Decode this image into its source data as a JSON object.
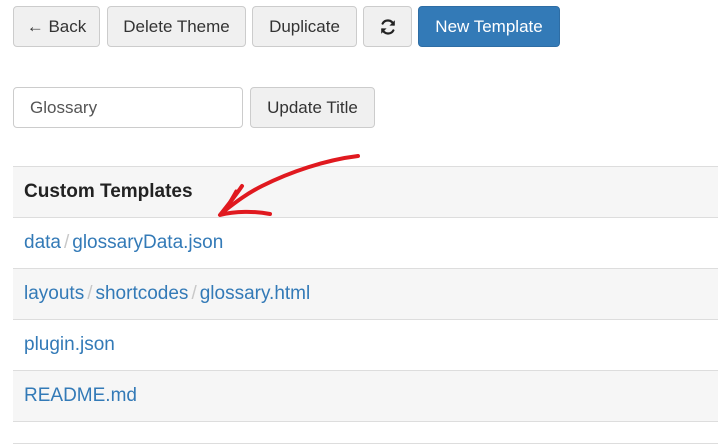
{
  "toolbar": {
    "back_label": "← Back",
    "delete_label": "Delete Theme",
    "duplicate_label": "Duplicate",
    "refresh_icon": "refresh-icon",
    "new_label": "New Template"
  },
  "title_form": {
    "value": "Glossary",
    "update_label": "Update Title"
  },
  "templates": {
    "header": "Custom Templates",
    "rows": [
      {
        "parts": [
          "data",
          "glossaryData.json"
        ]
      },
      {
        "parts": [
          "layouts",
          "shortcodes",
          "glossary.html"
        ]
      },
      {
        "parts": [
          "plugin.json"
        ]
      },
      {
        "parts": [
          "README.md"
        ]
      }
    ]
  },
  "colors": {
    "primary": "#337ab7",
    "annotation": "#e0191f"
  }
}
